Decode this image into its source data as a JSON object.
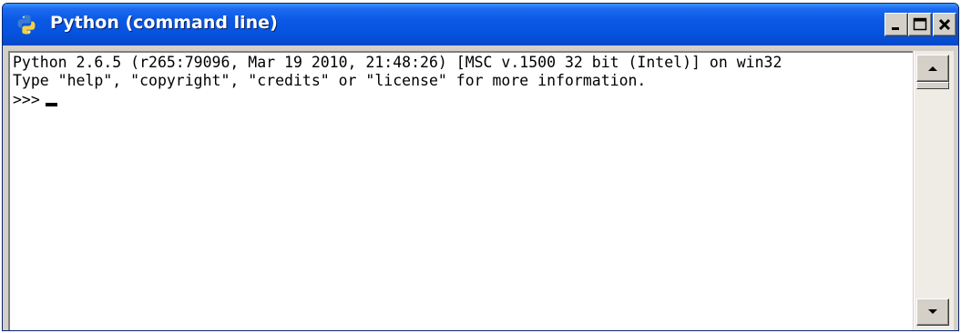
{
  "window": {
    "title": "Python (command line)",
    "app_icon": "python-icon",
    "accent_color": "#0553df",
    "controls": {
      "minimize_icon": "minimize-icon",
      "maximize_icon": "maximize-icon",
      "close_icon": "close-icon"
    }
  },
  "console": {
    "lines": [
      "Python 2.6.5 (r265:79096, Mar 19 2010, 21:48:26) [MSC v.1500 32 bit (Intel)] on win32",
      "Type \"help\", \"copyright\", \"credits\" or \"license\" for more information."
    ],
    "prompt": ">>>",
    "background": "#ffffff",
    "text_color": "#000000"
  },
  "scrollbar": {
    "up_icon": "arrow-up-icon",
    "down_icon": "arrow-down-icon"
  }
}
